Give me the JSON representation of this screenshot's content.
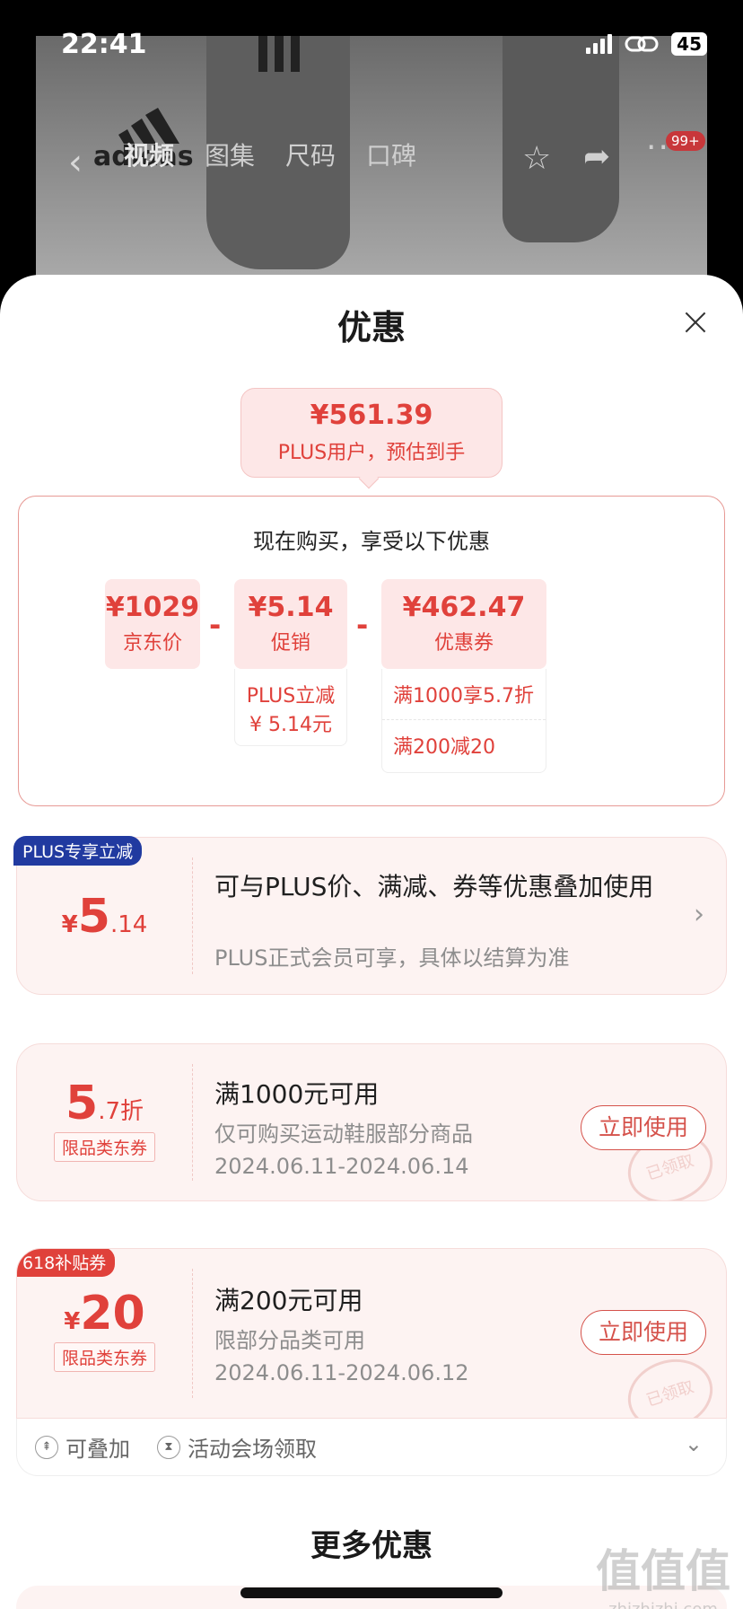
{
  "status_bar": {
    "time": "22:41",
    "battery": "45"
  },
  "nav": {
    "brand": "adidas",
    "tabs": [
      {
        "label": "视频",
        "active": true
      },
      {
        "label": "图集",
        "active": false
      },
      {
        "label": "尺码",
        "active": false
      },
      {
        "label": "口碑",
        "active": false
      }
    ],
    "more_badge": "99+"
  },
  "sheet": {
    "title": "优惠",
    "estimate": {
      "amount": "¥561.39",
      "desc": "PLUS用户，预估到手"
    },
    "breakdown": {
      "title": "现在购买，享受以下优惠",
      "items": [
        {
          "value": "¥1029",
          "label": "京东价"
        },
        {
          "value": "¥5.14",
          "label": "促销",
          "details": [
            "PLUS立减",
            "¥ 5.14元"
          ]
        },
        {
          "value": "¥462.47",
          "label": "优惠券",
          "details": [
            "满1000享5.7折",
            "满200减20"
          ]
        }
      ],
      "minus": "-"
    },
    "coupons": [
      {
        "tag": "PLUS专享立减",
        "currency": "¥",
        "value": "5",
        "decimal": ".14",
        "title": "可与PLUS价、满减、券等优惠叠加使用",
        "subtitle": "PLUS正式会员可享，具体以结算为准"
      },
      {
        "value": "5",
        "decimal": ".7折",
        "category": "限品类东券",
        "title": "满1000元可用",
        "subtitle": "仅可购买运动鞋服部分商品",
        "date": "2024.06.11-2024.06.14",
        "button": "立即使用",
        "stamp": "已领取"
      },
      {
        "tag": "618补贴券",
        "currency": "¥",
        "value": "20",
        "category": "限品类东券",
        "title": "满200元可用",
        "subtitle": "限部分品类可用",
        "date": "2024.06.11-2024.06.12",
        "button": "立即使用",
        "stamp": "已领取"
      }
    ],
    "footer": {
      "stackable": "可叠加",
      "venue": "活动会场领取"
    },
    "more_title": "更多优惠"
  },
  "watermark": {
    "logo": "值值值",
    "url": "zhizhizhi.com"
  },
  "colors": {
    "accent": "#e0413b",
    "plus_tag": "#213aa0",
    "pale_pink": "#fde7e7"
  }
}
